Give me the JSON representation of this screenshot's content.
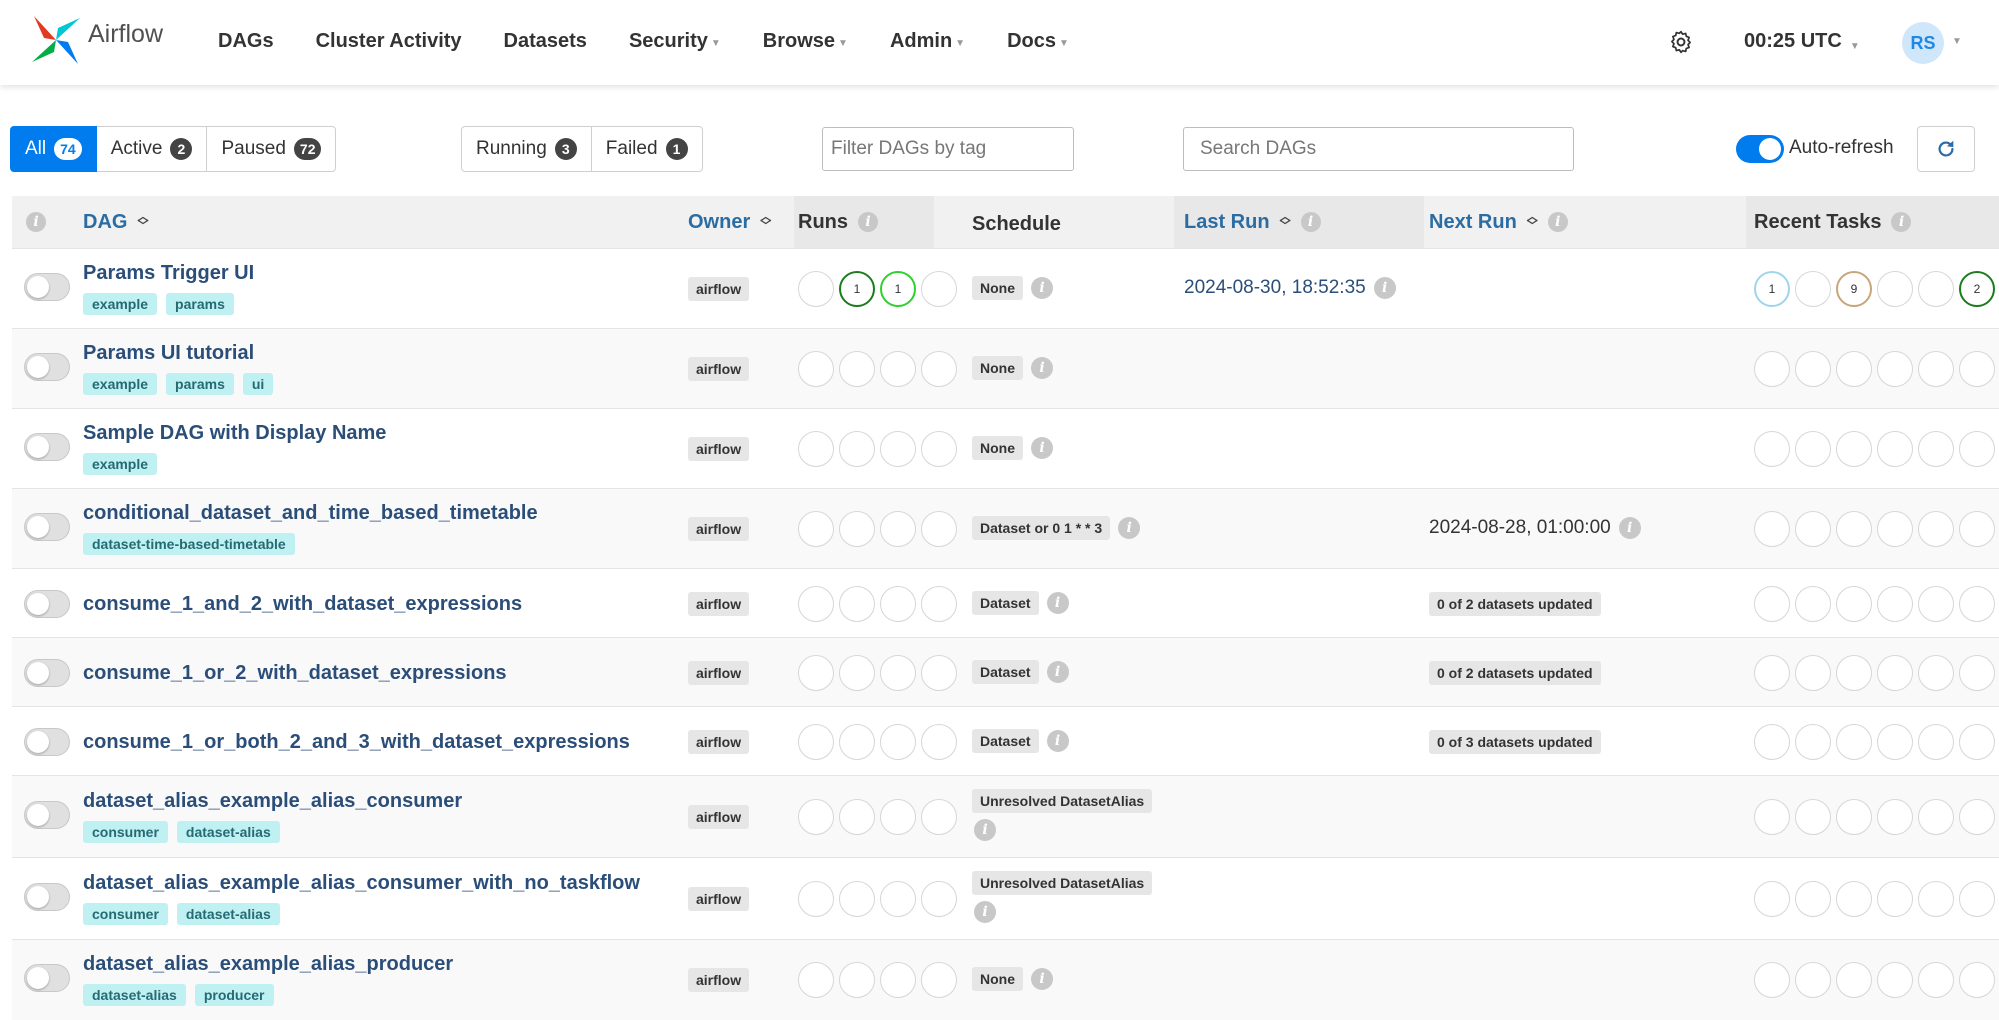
{
  "navbar": {
    "brand": "Airflow",
    "menu": [
      {
        "label": "DAGs",
        "dropdown": false
      },
      {
        "label": "Cluster Activity",
        "dropdown": false
      },
      {
        "label": "Datasets",
        "dropdown": false
      },
      {
        "label": "Security",
        "dropdown": true
      },
      {
        "label": "Browse",
        "dropdown": true
      },
      {
        "label": "Admin",
        "dropdown": true
      },
      {
        "label": "Docs",
        "dropdown": true
      }
    ],
    "time": "00:25 UTC",
    "avatar": "RS"
  },
  "filters": {
    "status": [
      {
        "label": "All",
        "count": "74",
        "active": true
      },
      {
        "label": "Active",
        "count": "2"
      },
      {
        "label": "Paused",
        "count": "72"
      }
    ],
    "runs": [
      {
        "label": "Running",
        "count": "3"
      },
      {
        "label": "Failed",
        "count": "1"
      }
    ],
    "tag_placeholder": "Filter DAGs by tag",
    "search_placeholder": "Search DAGs",
    "auto_refresh_label": "Auto-refresh"
  },
  "columns": {
    "dag": "DAG",
    "owner": "Owner",
    "runs": "Runs",
    "schedule": "Schedule",
    "last_run": "Last Run",
    "next_run": "Next Run",
    "recent_tasks": "Recent Tasks"
  },
  "dags": [
    {
      "name": "Params Trigger UI",
      "tags": [
        "example",
        "params"
      ],
      "owner": "airflow",
      "runs": [
        {
          "s": ""
        },
        {
          "s": "success",
          "n": "1"
        },
        {
          "s": "running",
          "n": "1"
        },
        {
          "s": ""
        }
      ],
      "schedule": "None",
      "last_run": "2024-08-30, 18:52:35",
      "next_run": "",
      "recent": [
        {
          "s": "queued",
          "n": "1"
        },
        {
          "s": ""
        },
        {
          "s": "tan",
          "n": "9"
        },
        {
          "s": ""
        },
        {
          "s": ""
        },
        {
          "s": "success",
          "n": "2"
        }
      ]
    },
    {
      "name": "Params UI tutorial",
      "tags": [
        "example",
        "params",
        "ui"
      ],
      "owner": "airflow",
      "runs": [
        {
          "s": ""
        },
        {
          "s": ""
        },
        {
          "s": ""
        },
        {
          "s": ""
        }
      ],
      "schedule": "None",
      "last_run": "",
      "next_run": "",
      "recent": [
        {
          "s": ""
        },
        {
          "s": ""
        },
        {
          "s": ""
        },
        {
          "s": ""
        },
        {
          "s": ""
        },
        {
          "s": ""
        }
      ]
    },
    {
      "name": "Sample DAG with Display Name",
      "tags": [
        "example"
      ],
      "owner": "airflow",
      "runs": [
        {
          "s": ""
        },
        {
          "s": ""
        },
        {
          "s": ""
        },
        {
          "s": ""
        }
      ],
      "schedule": "None",
      "last_run": "",
      "next_run": "",
      "recent": [
        {
          "s": ""
        },
        {
          "s": ""
        },
        {
          "s": ""
        },
        {
          "s": ""
        },
        {
          "s": ""
        },
        {
          "s": ""
        }
      ]
    },
    {
      "name": "conditional_dataset_and_time_based_timetable",
      "tags": [
        "dataset-time-based-timetable"
      ],
      "owner": "airflow",
      "runs": [
        {
          "s": ""
        },
        {
          "s": ""
        },
        {
          "s": ""
        },
        {
          "s": ""
        }
      ],
      "schedule": "Dataset or 0 1 * * 3",
      "last_run": "",
      "next_run": "2024-08-28, 01:00:00",
      "recent": [
        {
          "s": ""
        },
        {
          "s": ""
        },
        {
          "s": ""
        },
        {
          "s": ""
        },
        {
          "s": ""
        },
        {
          "s": ""
        }
      ]
    },
    {
      "name": "consume_1_and_2_with_dataset_expressions",
      "tags": [],
      "owner": "airflow",
      "runs": [
        {
          "s": ""
        },
        {
          "s": ""
        },
        {
          "s": ""
        },
        {
          "s": ""
        }
      ],
      "schedule": "Dataset",
      "last_run": "",
      "next_run_badge": "0 of 2 datasets updated",
      "recent": [
        {
          "s": ""
        },
        {
          "s": ""
        },
        {
          "s": ""
        },
        {
          "s": ""
        },
        {
          "s": ""
        },
        {
          "s": ""
        }
      ]
    },
    {
      "name": "consume_1_or_2_with_dataset_expressions",
      "tags": [],
      "owner": "airflow",
      "runs": [
        {
          "s": ""
        },
        {
          "s": ""
        },
        {
          "s": ""
        },
        {
          "s": ""
        }
      ],
      "schedule": "Dataset",
      "last_run": "",
      "next_run_badge": "0 of 2 datasets updated",
      "recent": [
        {
          "s": ""
        },
        {
          "s": ""
        },
        {
          "s": ""
        },
        {
          "s": ""
        },
        {
          "s": ""
        },
        {
          "s": ""
        }
      ]
    },
    {
      "name": "consume_1_or_both_2_and_3_with_dataset_expressions",
      "tags": [],
      "owner": "airflow",
      "runs": [
        {
          "s": ""
        },
        {
          "s": ""
        },
        {
          "s": ""
        },
        {
          "s": ""
        }
      ],
      "schedule": "Dataset",
      "last_run": "",
      "next_run_badge": "0 of 3 datasets updated",
      "recent": [
        {
          "s": ""
        },
        {
          "s": ""
        },
        {
          "s": ""
        },
        {
          "s": ""
        },
        {
          "s": ""
        },
        {
          "s": ""
        }
      ]
    },
    {
      "name": "dataset_alias_example_alias_consumer",
      "tags": [
        "consumer",
        "dataset-alias"
      ],
      "owner": "airflow",
      "runs": [
        {
          "s": ""
        },
        {
          "s": ""
        },
        {
          "s": ""
        },
        {
          "s": ""
        }
      ],
      "schedule": "Unresolved DatasetAlias",
      "schedule_multiline": true,
      "last_run": "",
      "next_run": "",
      "recent": [
        {
          "s": ""
        },
        {
          "s": ""
        },
        {
          "s": ""
        },
        {
          "s": ""
        },
        {
          "s": ""
        },
        {
          "s": ""
        }
      ]
    },
    {
      "name": "dataset_alias_example_alias_consumer_with_no_taskflow",
      "tags": [
        "consumer",
        "dataset-alias"
      ],
      "owner": "airflow",
      "runs": [
        {
          "s": ""
        },
        {
          "s": ""
        },
        {
          "s": ""
        },
        {
          "s": ""
        }
      ],
      "schedule": "Unresolved DatasetAlias",
      "schedule_multiline": true,
      "last_run": "",
      "next_run": "",
      "recent": [
        {
          "s": ""
        },
        {
          "s": ""
        },
        {
          "s": ""
        },
        {
          "s": ""
        },
        {
          "s": ""
        },
        {
          "s": ""
        }
      ]
    },
    {
      "name": "dataset_alias_example_alias_producer",
      "tags": [
        "dataset-alias",
        "producer"
      ],
      "owner": "airflow",
      "runs": [
        {
          "s": ""
        },
        {
          "s": ""
        },
        {
          "s": ""
        },
        {
          "s": ""
        }
      ],
      "schedule": "None",
      "last_run": "",
      "next_run": "",
      "recent": [
        {
          "s": ""
        },
        {
          "s": ""
        },
        {
          "s": ""
        },
        {
          "s": ""
        },
        {
          "s": ""
        },
        {
          "s": ""
        }
      ]
    }
  ]
}
